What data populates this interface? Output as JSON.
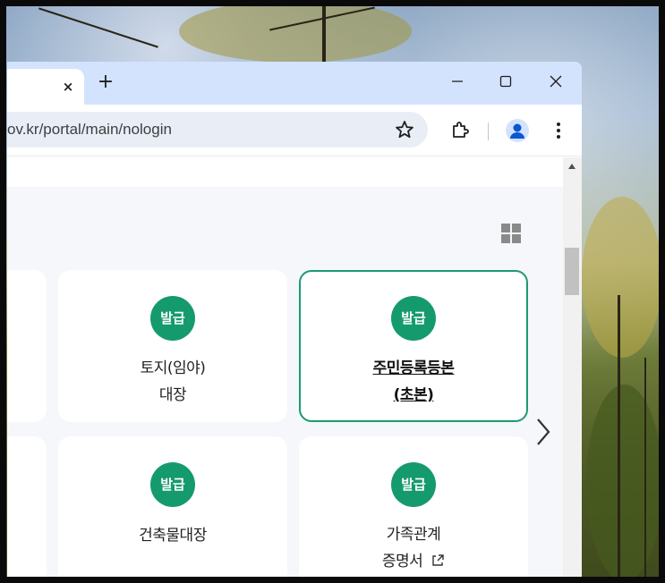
{
  "browser": {
    "tab_close": "×",
    "new_tab": "+",
    "window_controls": {
      "minimize": "—",
      "maximize": "☐",
      "close": "✕"
    },
    "url": "ov.kr/portal/main/nologin",
    "icons": [
      "star-icon",
      "extension-icon",
      "profile-icon",
      "more-menu-icon"
    ]
  },
  "page": {
    "cards": [
      {
        "badge": "발급",
        "label_line1": "토지(임야)",
        "label_line2": "대장",
        "active": false
      },
      {
        "badge": "발급",
        "label_line1": "주민등록등본",
        "label_line2": "(초본)",
        "active": true
      },
      {
        "badge": "발급",
        "label_line1": "건축물대장",
        "label_line2": "",
        "active": false
      },
      {
        "badge": "발급",
        "label_line1": "가족관계",
        "label_line2": "증명서",
        "external_link": true,
        "active": false
      }
    ],
    "colors": {
      "accent_green": "#159a6e",
      "active_border": "#1d9a72"
    }
  }
}
